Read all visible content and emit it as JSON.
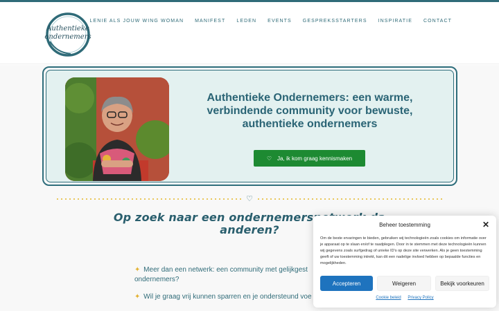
{
  "header": {
    "logo_text": [
      "Authentieke",
      "ondernemers"
    ],
    "nav": [
      "LENIE ALS JOUW WING WOMAN",
      "MANIFEST",
      "LEDEN",
      "EVENTS",
      "GESPREKSSTARTERS",
      "INSPIRATIE",
      "CONTACT"
    ]
  },
  "hero": {
    "title": "Authentieke Ondernemers: een warme, verbindende community voor bewuste, authentieke ondernemers",
    "cta_label": "Ja, ik kom graag kennismaken"
  },
  "section": {
    "heading_visible": "Op zoek naar een ondernemersnetwerk da",
    "heading_tail_fragment": "...",
    "heading_line2": "anderen?",
    "bullets": [
      "Meer dan een netwerk: een community met gelijkgest",
      "ondernemers?",
      "Wil je graag vrij kunnen sparren en je ondersteund voe"
    ]
  },
  "consent": {
    "title": "Beheer toestemming",
    "body": "Om de beste ervaringen te bieden, gebruiken wij technologieën zoals cookies om informatie over je apparaat op te slaan en/of te raadplegen. Door in te stemmen met deze technologieën kunnen wij gegevens zoals surfgedrag of unieke ID's op deze site verwerken. Als je geen toestemming geeft of uw toestemming intrekt, kan dit een nadelige invloed hebben op bepaalde functies en mogelijkheden.",
    "accept": "Accepteren",
    "deny": "Weigeren",
    "preferences": "Bekijk voorkeuren",
    "cookie_policy": "Cookie beleid",
    "privacy_policy": "Privacy Policy"
  },
  "colors": {
    "brand": "#2f6b78",
    "cta_green": "#1d8a32",
    "accent_gold": "#e8c24b",
    "accept_blue": "#1e73be"
  }
}
